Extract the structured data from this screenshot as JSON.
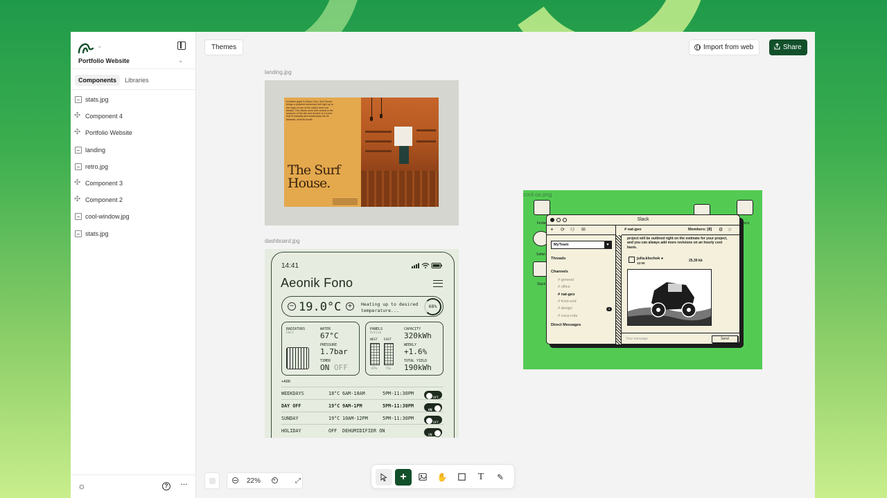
{
  "sidebar": {
    "project": "Portfolio Website",
    "tabs": [
      "Components",
      "Libraries"
    ],
    "items": [
      {
        "label": "stats.jpg",
        "icon": "image-icon"
      },
      {
        "label": "Component 4",
        "icon": "component-icon"
      },
      {
        "label": "Portfolio Website",
        "icon": "component-icon"
      },
      {
        "label": "landing",
        "icon": "image-icon"
      },
      {
        "label": "retro.jpg",
        "icon": "image-icon"
      },
      {
        "label": "Component 3",
        "icon": "component-icon"
      },
      {
        "label": "Component 2",
        "icon": "component-icon"
      },
      {
        "label": "cool-window.jpg",
        "icon": "image-icon"
      },
      {
        "label": "stats.jpg",
        "icon": "image-icon"
      }
    ]
  },
  "toolbar": {
    "themes_label": "Themes",
    "import_label": "Import from web",
    "share_label": "Share"
  },
  "frames": {
    "landing": {
      "label": "landing.jpg",
      "title_line1": "The Surf",
      "title_line2": "House.",
      "blurb": "A hidden jewel in Santa Cruz, Surf House brings a polished bohemian feel right up to the edge of one of the state's best surf breaks. The clients were well versed in the nuances of the site and dreamt of a home that fit naturally and sustainably into its fantastic, eclectic locale."
    },
    "dashboard": {
      "label": "dashboard.jpg",
      "time": "14:41",
      "title": "Aeonik Fono",
      "temperature": "19.0°C",
      "temp_note": "Heating up to desired temperature...",
      "progress": "68%",
      "radiators": {
        "label": "RADIATORS",
        "edit": "Edit",
        "water_label": "WATER",
        "water": "67°C",
        "pressure_label": "PRESSURE",
        "pressure": "1.7bar",
        "timer_label": "TIMER",
        "timer_on": "ON",
        "timer_off": "OFF"
      },
      "panels": {
        "label": "PANELS",
        "status": "Active",
        "west": "WEST",
        "east": "EAST",
        "west_pct": "67%",
        "east_pct": "72%",
        "capacity_label": "CAPACITY",
        "capacity": "320kWh",
        "weekly_label": "WEEKLY",
        "weekly": "+1.6%",
        "total_label": "TOTAL YIELD",
        "total": "190kWh"
      },
      "add_label": "+ADD",
      "schedule": [
        {
          "day": "WEEKDAYS",
          "temp": "18°C",
          "t1": "6AM-10AM",
          "t2": "5PM-11:30PM",
          "state": "OFF",
          "bold": false
        },
        {
          "day": "DAY OFF",
          "temp": "19°C",
          "t1": "9AM-1PM",
          "t2": "5PM-11:30PM",
          "state": "ON",
          "bold": true
        },
        {
          "day": "SUNDAY",
          "temp": "19°C",
          "t1": "10AM-12PM",
          "t2": "5PM-11:30PM",
          "state": "OFF",
          "bold": false
        },
        {
          "day": "HOLIDAY",
          "temp": "OFF",
          "t1": "DEHUMIDIFIER ON",
          "t2": "",
          "state": "ON",
          "bold": false
        }
      ]
    },
    "coolos": {
      "label": "cool-os.png",
      "desk_icons": [
        "Finder",
        "Safari",
        "Slack",
        "Docs"
      ],
      "window_title": "Slack",
      "team": "MyTeam",
      "threads": "Threads",
      "channels_label": "Channels",
      "channels": [
        "# general",
        "# office",
        "# nat-geo",
        "# front-end",
        "# design",
        "# coca-cola"
      ],
      "nat_geo_badge": "4",
      "dm_label": "Direct Messages",
      "channel_header": "# nat-geo",
      "members": "Members: [8]",
      "message": "project will be outlined right on the estimate for your project, and you can always add more revisions on an hourly cost basis.",
      "user": "julia.klochok ●",
      "user_time": "12:00",
      "file_size": "25,39 kb",
      "compose_placeholder": "Your message",
      "send": "Send"
    }
  },
  "zoom": "22%",
  "colors": {
    "accent": "#12502a",
    "desktop_green": "#53cb53",
    "landing_orange": "#e4a84d"
  }
}
